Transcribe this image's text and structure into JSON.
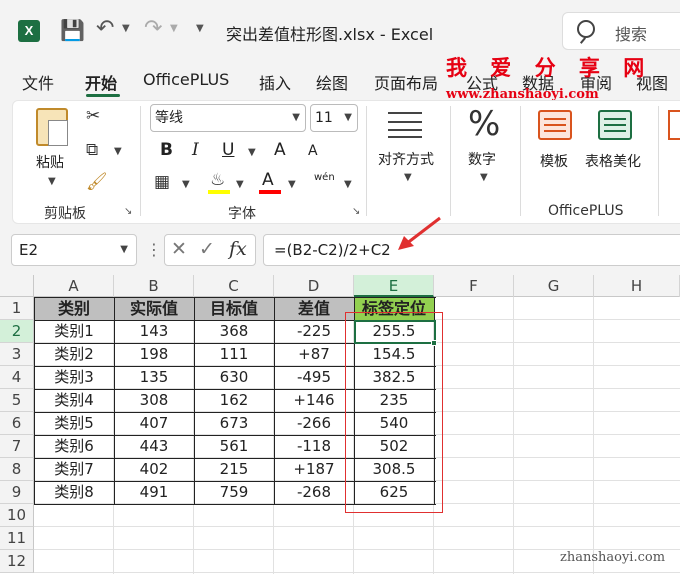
{
  "titlebar": {
    "doc_title": "突出差值柱形图.xlsx  -  Excel",
    "search_label": "搜索",
    "excel_logo": "X",
    "icons": [
      "excel-logo",
      "save-icon",
      "undo-icon",
      "redo-icon",
      "customize-icon"
    ]
  },
  "menu": {
    "tabs": [
      "文件",
      "开始",
      "OfficePLUS",
      "插入",
      "绘图",
      "页面布局",
      "公式",
      "数据",
      "审阅",
      "视图"
    ],
    "active": "开始"
  },
  "watermark": {
    "top": "我 爱 分 享 网",
    "url": "www.zhanshaoyi.com",
    "bottom": "zhanshaoyi.com"
  },
  "ribbon": {
    "paste_label": "粘贴",
    "clipboard_label": "剪贴板",
    "font_name": "等线",
    "font_size": "11",
    "font_group_label": "字体",
    "bold": "B",
    "italic": "I",
    "underline": "U",
    "grow": "A",
    "shrink": "A",
    "font_color": "A",
    "phonetic": "wén",
    "align_label": "对齐方式",
    "number_label": "数字",
    "number_glyph": "%",
    "template_label": "模板",
    "table_style_label": "表格美化",
    "officeplus_label": "OfficePLUS"
  },
  "formula_bar": {
    "name_box": "E2",
    "formula": "=(B2-C2)/2+C2",
    "cancel_glyph": "✕",
    "enter_glyph": "✓",
    "fx_glyph": "fx"
  },
  "sheet": {
    "columns": [
      "A",
      "B",
      "C",
      "D",
      "E",
      "F",
      "G",
      "H"
    ],
    "rows": [
      "1",
      "2",
      "3",
      "4",
      "5",
      "6",
      "7",
      "8",
      "9",
      "10",
      "11",
      "12"
    ],
    "headers": [
      "类别",
      "实际值",
      "目标值",
      "差值",
      "标签定位"
    ],
    "data": [
      [
        "类别1",
        "143",
        "368",
        "-225",
        "255.5"
      ],
      [
        "类别2",
        "198",
        "111",
        "+87",
        "154.5"
      ],
      [
        "类别3",
        "135",
        "630",
        "-495",
        "382.5"
      ],
      [
        "类别4",
        "308",
        "162",
        "+146",
        "235"
      ],
      [
        "类别5",
        "407",
        "673",
        "-266",
        "540"
      ],
      [
        "类别6",
        "443",
        "561",
        "-118",
        "502"
      ],
      [
        "类别7",
        "402",
        "215",
        "+187",
        "308.5"
      ],
      [
        "类别8",
        "491",
        "759",
        "-268",
        "625"
      ]
    ],
    "selected_cell": "E2",
    "colors": {
      "header_gray": "#bfbfbf",
      "header_green": "#92d050",
      "accent": "#1d6f42",
      "highlight_red": "#e03030"
    }
  }
}
